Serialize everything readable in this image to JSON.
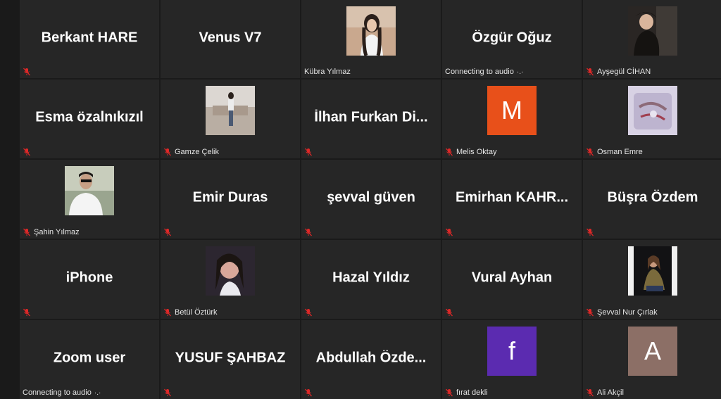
{
  "colors": {
    "background": "#1a1a1a",
    "tile": "#262626",
    "mute_red": "#e02828"
  },
  "participants": [
    {
      "display_name": "Berkant HARE",
      "footer": "",
      "muted": true
    },
    {
      "display_name": "Venus V7",
      "footer": "",
      "muted": false
    },
    {
      "display_name": "",
      "footer": "Kübra Yılmaz",
      "muted": false,
      "media": "photo"
    },
    {
      "display_name": "Özgür Oğuz",
      "footer": "Connecting to audio",
      "muted": false,
      "connecting": true
    },
    {
      "display_name": "",
      "footer": "Ayşegül CİHAN",
      "muted": true,
      "media": "photo"
    },
    {
      "display_name": "Esma özalnıkızıl",
      "footer": "",
      "muted": true
    },
    {
      "display_name": "",
      "footer": "Gamze Çelik",
      "muted": true,
      "media": "photo"
    },
    {
      "display_name": "İlhan Furkan Di...",
      "footer": "",
      "muted": true
    },
    {
      "display_name": "",
      "footer": "Melis Oktay",
      "muted": true,
      "media": "avatar",
      "avatar_letter": "M",
      "avatar_color": "#e8501a"
    },
    {
      "display_name": "",
      "footer": "Osman Emre",
      "muted": true,
      "media": "photo"
    },
    {
      "display_name": "",
      "footer": "Şahin Yılmaz",
      "muted": true,
      "media": "photo"
    },
    {
      "display_name": "Emir Duras",
      "footer": "",
      "muted": true
    },
    {
      "display_name": "şevval güven",
      "footer": "",
      "muted": true
    },
    {
      "display_name": "Emirhan  KAHR...",
      "footer": "",
      "muted": true
    },
    {
      "display_name": "Büşra Özdem",
      "footer": "",
      "muted": true
    },
    {
      "display_name": "iPhone",
      "footer": "",
      "muted": true
    },
    {
      "display_name": "",
      "footer": "Betül Öztürk",
      "muted": true,
      "media": "photo"
    },
    {
      "display_name": "Hazal Yıldız",
      "footer": "",
      "muted": true
    },
    {
      "display_name": "Vural Ayhan",
      "footer": "",
      "muted": true
    },
    {
      "display_name": "",
      "footer": "Şevval Nur Çırlak",
      "muted": true,
      "media": "photo"
    },
    {
      "display_name": "Zoom user",
      "footer": "Connecting to audio",
      "muted": false,
      "connecting": true
    },
    {
      "display_name": "YUSUF ŞAHBAZ",
      "footer": "",
      "muted": true
    },
    {
      "display_name": "Abdullah  Özde...",
      "footer": "",
      "muted": true
    },
    {
      "display_name": "",
      "footer": "fırat dekli",
      "muted": true,
      "media": "avatar",
      "avatar_letter": "f",
      "avatar_color": "#5b2bb0"
    },
    {
      "display_name": "",
      "footer": "Ali Akçil",
      "muted": true,
      "media": "avatar",
      "avatar_letter": "A",
      "avatar_color": "#8c6f66"
    }
  ]
}
